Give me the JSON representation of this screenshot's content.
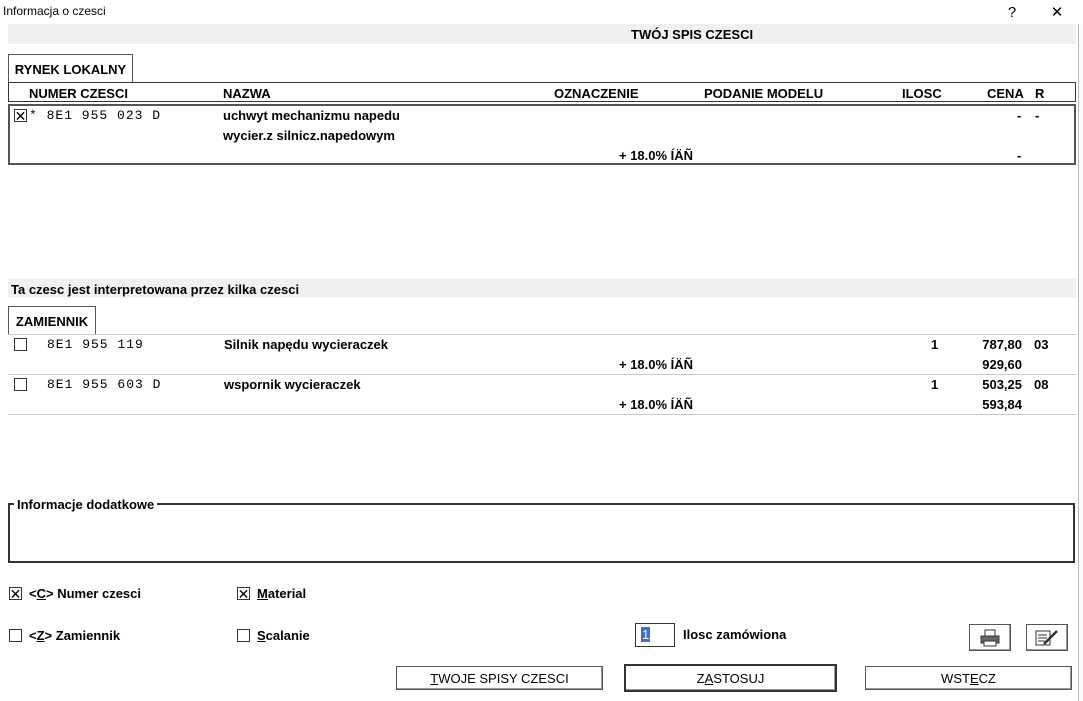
{
  "window": {
    "title": "Informacja o czesci",
    "help_label": "?",
    "close_label": "✕"
  },
  "header": {
    "title": "TWÓJ SPIS CZESCI"
  },
  "tab_local": "RYNEK LOKALNY",
  "columns": {
    "number": "NUMER CZESCI",
    "name": "NAZWA",
    "designation": "OZNACZENIE",
    "model": "PODANIE MODELU",
    "qty": "ILOSC",
    "price": "CENA",
    "r": "R"
  },
  "main_part": {
    "checked": true,
    "number": "* 8E1 955 023 D",
    "name_line1": "uchwyt mechanizmu napedu",
    "name_line2": "wycier.z silnicz.napedowym",
    "vat": "+ 18.0% ÍÄÑ",
    "price": "-",
    "r": "-",
    "price2": "-"
  },
  "interpretation_note": "Ta czesc jest interpretowana przez kilka czesci",
  "tab_replacement": "ZAMIENNIK",
  "replacements": [
    {
      "number": "8E1 955 119",
      "name": "Silnik napędu wycieraczek",
      "qty": "1",
      "price": "787,80",
      "r": "03",
      "vat": "+ 18.0% ÍÄÑ",
      "price_gross": "929,60"
    },
    {
      "number": "8E1 955 603 D",
      "name": "wspornik wycieraczek",
      "qty": "1",
      "price": "503,25",
      "r": "08",
      "vat": "+ 18.0% ÍÄÑ",
      "price_gross": "593,84"
    }
  ],
  "additional_info": {
    "label": "Informacje dodatkowe"
  },
  "options": {
    "part_number": {
      "prefix": "<",
      "key": "C",
      "suffix": "> Numer czesci",
      "checked": true
    },
    "material": {
      "key": "M",
      "rest": "aterial",
      "checked": true
    },
    "replacement": {
      "prefix": "<",
      "key": "Z",
      "suffix": "> Zamiennik",
      "checked": false
    },
    "merge": {
      "key": "S",
      "rest": "calanie",
      "checked": false
    }
  },
  "quantity": {
    "value": "1",
    "label": "Ilosc zamówiona"
  },
  "buttons": {
    "lists": {
      "key": "T",
      "rest": "WOJE SPISY CZESCI"
    },
    "apply_a": "Z",
    "apply_key": "A",
    "apply_b": "STOSUJ",
    "back_a": "WST",
    "back_key": "E",
    "back_b": "CZ"
  }
}
